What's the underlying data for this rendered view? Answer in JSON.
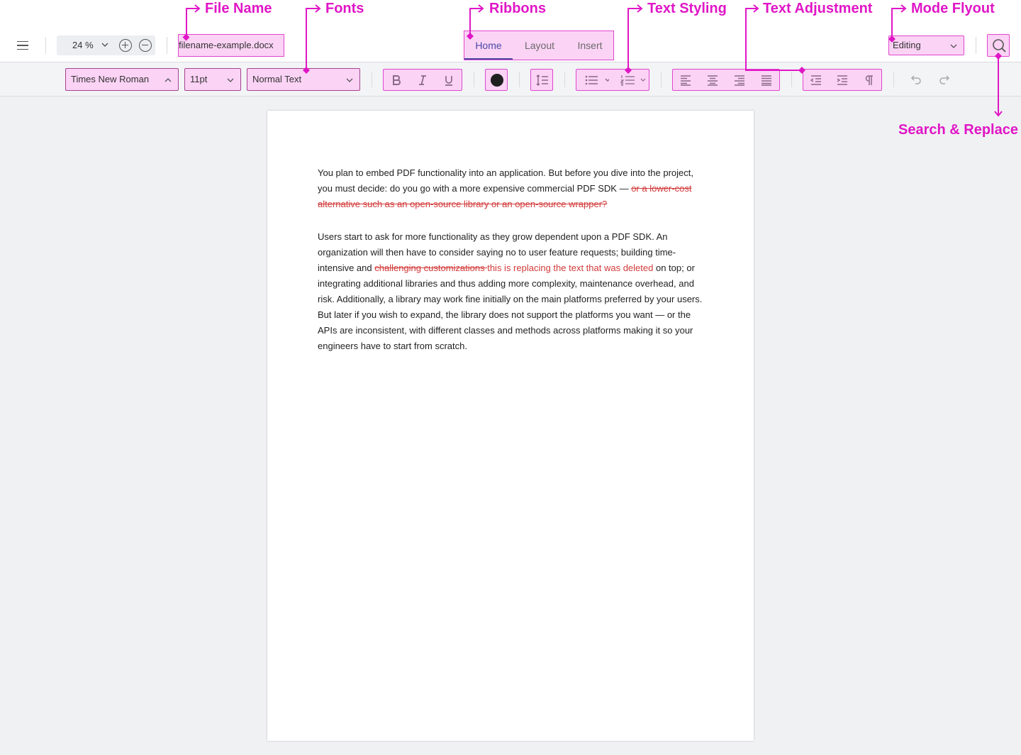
{
  "annotations": {
    "file_name": "File Name",
    "fonts": "Fonts",
    "ribbons": "Ribbons",
    "text_styling": "Text Styling",
    "text_adjustment": "Text Adjustment",
    "mode_flyout": "Mode Flyout",
    "search_replace": "Search & Replace"
  },
  "topbar": {
    "zoom_value": "24 %",
    "filename": "filename-example.docx",
    "tabs": [
      "Home",
      "Layout",
      "Insert"
    ],
    "active_tab": "Home",
    "mode": "Editing"
  },
  "toolbar": {
    "font_family": "Times New Roman",
    "font_size": "11pt",
    "paragraph_style": "Normal Text",
    "text_color": "#1f1f1f"
  },
  "document": {
    "p1": {
      "text": "You plan to embed PDF functionality into an application. But before you dive into the project, you must decide: do you go with a more expensive commercial PDF SDK — ",
      "deleted": "or a lower-cost alternative such as an open-source library or an open-source wrapper?"
    },
    "p2": {
      "before": "Users start to ask for more functionality as they grow dependent upon a PDF SDK. An organization will then have to consider saying no to user feature requests; building time-intensive and ",
      "deleted": "challenging customizations ",
      "inserted": "this is replacing the text that was deleted",
      "after": " on top; or integrating additional libraries and thus adding more complexity, maintenance overhead, and risk. Additionally, a library may work fine initially on the main platforms preferred by your users. But later if you wish to expand, the library does not support the platforms you want — or the APIs are inconsistent, with different classes and methods across platforms making it so your engineers have to start from scratch."
    }
  },
  "colors": {
    "annotation": "#e016c6",
    "highlight": "#fbd3f5",
    "active_tab": "#4a4aa6",
    "tracked_change": "#d33a3a"
  }
}
